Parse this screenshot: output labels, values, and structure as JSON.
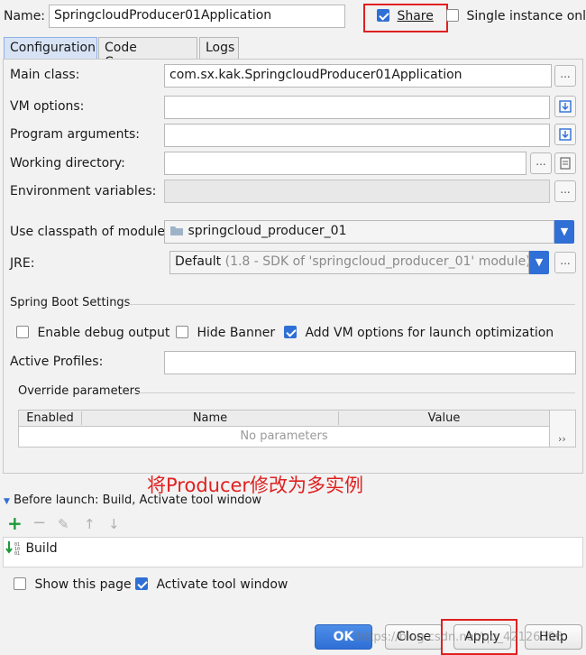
{
  "header": {
    "name_label": "Name:",
    "name_value": "SpringcloudProducer01Application",
    "share_label": "Share",
    "share_checked": true,
    "single_instance_label": "Single instance only",
    "single_instance_checked": false
  },
  "tabs": [
    {
      "label": "Configuration",
      "active": true
    },
    {
      "label": "Code Coverage",
      "active": false
    },
    {
      "label": "Logs",
      "active": false
    }
  ],
  "form": {
    "main_class_label": "Main class:",
    "main_class_value": "com.sx.kak.SpringcloudProducer01Application",
    "vm_options_label": "VM options:",
    "program_args_label": "Program arguments:",
    "working_dir_label": "Working directory:",
    "env_vars_label": "Environment variables:",
    "classpath_label": "Use classpath of module:",
    "classpath_value": "springcloud_producer_01",
    "jre_label": "JRE:",
    "jre_value": "Default",
    "jre_detail": "(1.8 - SDK of 'springcloud_producer_01' module)",
    "browse_glyph": "..."
  },
  "spring_boot": {
    "section_title": "Spring Boot Settings",
    "debug_label": "Enable debug output",
    "debug_checked": false,
    "hide_banner_label": "Hide Banner",
    "hide_banner_checked": false,
    "add_vm_label": "Add VM options for launch optimization",
    "add_vm_checked": true,
    "active_profiles_label": "Active Profiles:",
    "override_title": "Override parameters",
    "table_columns": [
      "Enabled",
      "Name",
      "Value"
    ],
    "empty_text": "No parameters",
    "more_glyph": "››"
  },
  "annotation": {
    "text": "将Producer修改为多实例",
    "color": "#e02020"
  },
  "before_launch": {
    "title": "Before launch: Build, Activate tool window",
    "items": [
      "Build"
    ],
    "toolbar": {
      "add": "+",
      "remove": "−",
      "edit": "✎",
      "up": "↑",
      "down": "↓"
    }
  },
  "footer": {
    "show_page_label": "Show this page",
    "show_page_checked": false,
    "activate_label": "Activate tool window",
    "activate_checked": true,
    "ok_label": "OK",
    "close_label": "Close",
    "apply_label": "Apply",
    "help_label": "Help"
  },
  "watermark": "https://blog.csdn.net/qq_42126396"
}
